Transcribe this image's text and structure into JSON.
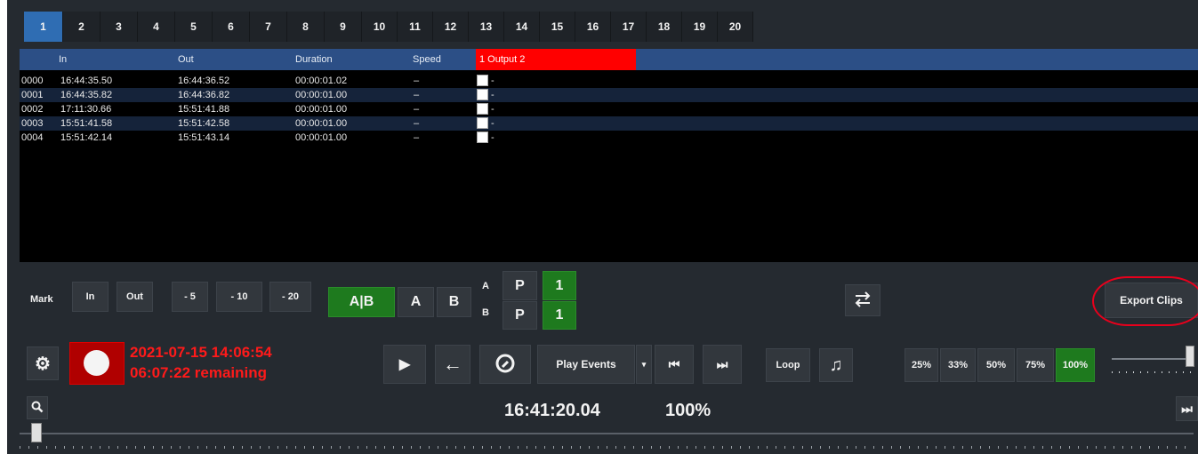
{
  "tabs": [
    "1",
    "2",
    "3",
    "4",
    "5",
    "6",
    "7",
    "8",
    "9",
    "10",
    "11",
    "12",
    "13",
    "14",
    "15",
    "16",
    "17",
    "18",
    "19",
    "20"
  ],
  "table": {
    "headers": {
      "in": "In",
      "out": "Out",
      "duration": "Duration",
      "speed": "Speed",
      "output": "1 Output 2"
    },
    "rows": [
      {
        "id": "0000",
        "in": "16:44:35.50",
        "out": "16:44:36.52",
        "duration": "00:00:01.02",
        "speed": "–",
        "note": "-"
      },
      {
        "id": "0001",
        "in": "16:44:35.82",
        "out": "16:44:36.82",
        "duration": "00:00:01.00",
        "speed": "–",
        "note": "-"
      },
      {
        "id": "0002",
        "in": "17:11:30.66",
        "out": "15:51:41.88",
        "duration": "00:00:01.00",
        "speed": "–",
        "note": "-"
      },
      {
        "id": "0003",
        "in": "15:51:41.58",
        "out": "15:51:42.58",
        "duration": "00:00:01.00",
        "speed": "–",
        "note": "-"
      },
      {
        "id": "0004",
        "in": "15:51:42.14",
        "out": "15:51:43.14",
        "duration": "00:00:01.00",
        "speed": "–",
        "note": "-"
      }
    ]
  },
  "mark": {
    "label": "Mark",
    "in": "In",
    "out": "Out",
    "m5": "- 5",
    "m10": "- 10",
    "m20": "- 20"
  },
  "ab": {
    "ab": "A|B",
    "a": "A",
    "b": "B",
    "row_a": "A",
    "row_b": "B",
    "p": "P",
    "one": "1"
  },
  "export_clips": "Export Clips",
  "recording": {
    "datetime": "2021-07-15 14:06:54",
    "remaining": "06:07:22 remaining"
  },
  "transport": {
    "play_events": "Play Events",
    "loop": "Loop"
  },
  "zoom": {
    "options": [
      "25%",
      "33%",
      "50%",
      "75%",
      "100%"
    ],
    "selected": "100%"
  },
  "status": {
    "timecode": "16:41:20.04",
    "speed": "100%"
  },
  "icons": [
    "gear-icon",
    "record-icon",
    "play-icon",
    "back-arrow-icon",
    "replay-icon",
    "chevron-down-icon",
    "skip-back-icon",
    "skip-forward-icon",
    "music-note-icon",
    "swap-icon",
    "search-icon",
    "fast-forward-icon"
  ],
  "colors": {
    "accent": "#2f6db3",
    "output": "#ff0000",
    "green": "#1e7a1e",
    "record": "#cc1111"
  }
}
